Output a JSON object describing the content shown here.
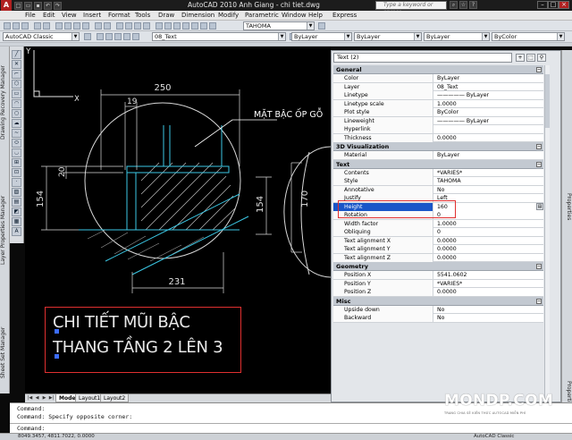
{
  "window": {
    "title": "AutoCAD 2010    Anh Giang - chi tiet.dwg",
    "search_placeholder": "Type a keyword or phrase"
  },
  "menu": [
    "File",
    "Edit",
    "View",
    "Insert",
    "Format",
    "Tools",
    "Draw",
    "Dimension",
    "Modify",
    "Parametric",
    "Window",
    "Help",
    "Express"
  ],
  "toolbar": {
    "workspace": "AutoCAD Classic",
    "layer": "08_Text",
    "color": "ByLayer",
    "textstyle": "TAHOMA",
    "linetype": "ByLayer",
    "lineweight": "ByLayer",
    "plotstyle": "ByColor"
  },
  "left_palettes": [
    "Drawing Recovery Manager",
    "Layer Properties Manager",
    "Sheet Set Manager"
  ],
  "drawing": {
    "dims": {
      "d250": "250",
      "d19": "19",
      "d20": "20",
      "d154a": "154",
      "d154b": "154",
      "d170": "170",
      "d231": "231"
    },
    "label": "MẶT BẬC ỐP GỖ",
    "title_line1": "CHI TIẾT MŨI BẬC",
    "title_line2": "THANG TẦNG 2 LÊN 3",
    "ucs_x": "X",
    "ucs_y": "Y"
  },
  "layout_tabs": [
    {
      "label": "Model",
      "active": true
    },
    {
      "label": "Layout1",
      "active": false
    },
    {
      "label": "Layout2",
      "active": false
    }
  ],
  "command": {
    "line1": "Command:",
    "line2": "Command: Specify opposite corner:",
    "prompt": "Command:"
  },
  "status": {
    "coords": "8049.3457, 4811.7022, 0.0000",
    "right": "AutoCAD Classic"
  },
  "properties": {
    "selection": "Text (2)",
    "palette_label": "Properties",
    "sections": [
      {
        "name": "General",
        "rows": [
          {
            "k": "Color",
            "v": "ByLayer"
          },
          {
            "k": "Layer",
            "v": "08_Text"
          },
          {
            "k": "Linetype",
            "v": "————— ByLayer"
          },
          {
            "k": "Linetype scale",
            "v": "1.0000"
          },
          {
            "k": "Plot style",
            "v": "ByColor"
          },
          {
            "k": "Lineweight",
            "v": "————— ByLayer"
          },
          {
            "k": "Hyperlink",
            "v": ""
          },
          {
            "k": "Thickness",
            "v": "0.0000"
          }
        ]
      },
      {
        "name": "3D Visualization",
        "rows": [
          {
            "k": "Material",
            "v": "ByLayer"
          }
        ]
      },
      {
        "name": "Text",
        "rows": [
          {
            "k": "Contents",
            "v": "*VARIES*"
          },
          {
            "k": "Style",
            "v": "TAHOMA"
          },
          {
            "k": "Annotative",
            "v": "No"
          },
          {
            "k": "Justify",
            "v": "Left"
          },
          {
            "k": "Height",
            "v": "160",
            "selected": true
          },
          {
            "k": "Rotation",
            "v": "0"
          },
          {
            "k": "Width factor",
            "v": "1.0000"
          },
          {
            "k": "Obliquing",
            "v": "0"
          },
          {
            "k": "Text alignment X",
            "v": "0.0000"
          },
          {
            "k": "Text alignment Y",
            "v": "0.0000"
          },
          {
            "k": "Text alignment Z",
            "v": "0.0000"
          }
        ]
      },
      {
        "name": "Geometry",
        "rows": [
          {
            "k": "Position X",
            "v": "5541.0602"
          },
          {
            "k": "Position Y",
            "v": "*VARIES*"
          },
          {
            "k": "Position Z",
            "v": "0.0000"
          }
        ]
      },
      {
        "name": "Misc",
        "rows": [
          {
            "k": "Upside down",
            "v": "No"
          },
          {
            "k": "Backward",
            "v": "No"
          }
        ]
      }
    ]
  },
  "watermark": {
    "brand": "MONDP.COM",
    "tagline": "TRANG CHIA SẺ KIẾN THỨC AUTOCAD MIỄN PHÍ"
  }
}
